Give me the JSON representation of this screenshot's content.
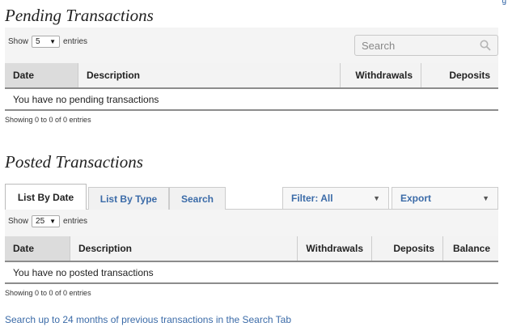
{
  "corner_mark": "g",
  "pending": {
    "title": "Pending Transactions",
    "show_label": "Show",
    "entries_label": "entries",
    "page_length": "5",
    "search_placeholder": "Search",
    "columns": [
      "Date",
      "Description",
      "Withdrawals",
      "Deposits"
    ],
    "empty_message": "You have no pending transactions",
    "info": "Showing 0 to 0 of 0 entries"
  },
  "posted": {
    "title": "Posted Transactions",
    "tabs": [
      "List By Date",
      "List By Type",
      "Search"
    ],
    "active_tab": "List By Date",
    "filter_label": "Filter: All",
    "export_label": "Export",
    "show_label": "Show",
    "entries_label": "entries",
    "page_length": "25",
    "columns": [
      "Date",
      "Description",
      "Withdrawals",
      "Deposits",
      "Balance"
    ],
    "empty_message": "You have no posted transactions",
    "info": "Showing 0 to 0 of 0 entries"
  },
  "footnote": "Search up to 24 months of previous transactions in the Search Tab",
  "colors": {
    "link": "#3b6ba8",
    "header_bg": "#f3f3f3",
    "sorted_header_bg": "#dcdcdc",
    "rule": "#8c8c8c"
  }
}
